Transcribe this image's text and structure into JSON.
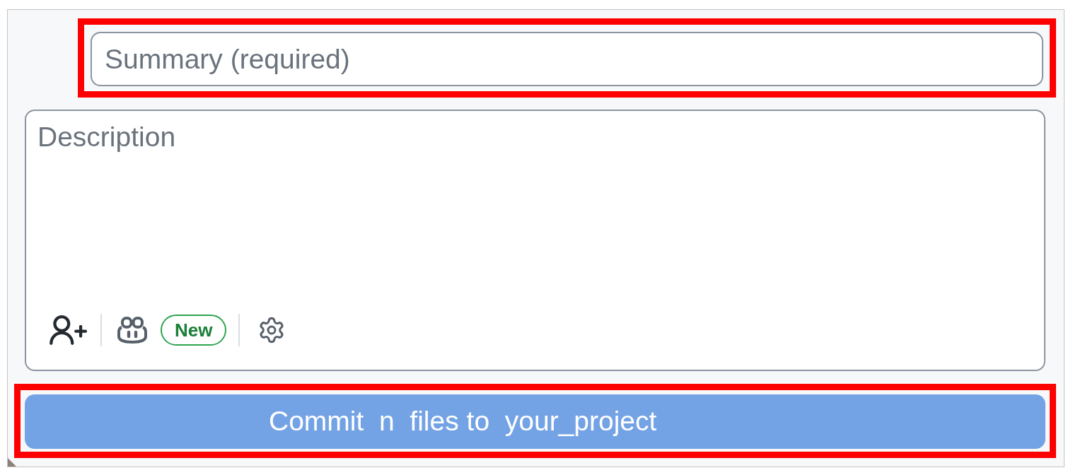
{
  "summary": {
    "placeholder": "Summary (required)",
    "highlighted": true
  },
  "description": {
    "placeholder": "Description",
    "badge": "New"
  },
  "commit_button": {
    "label": "Commit  n  files to  your_project",
    "disabled": true,
    "highlighted": true
  }
}
